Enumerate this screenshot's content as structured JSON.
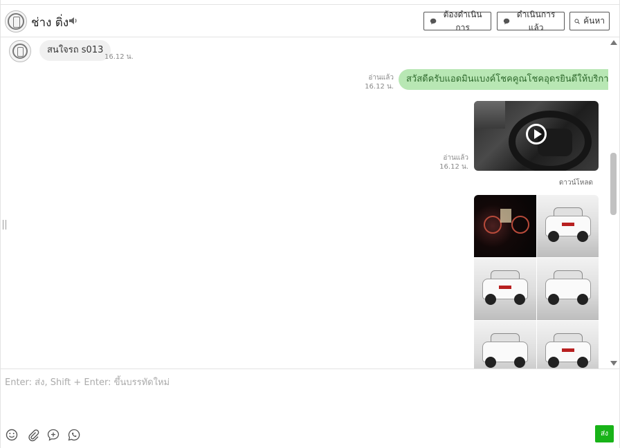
{
  "header": {
    "contact_name": "ช่าง ติ่ง",
    "btn_todo": "ต้องดำเนินการ",
    "btn_done": "ดำเนินการแล้ว",
    "btn_search": "ค้นหา"
  },
  "messages": {
    "incoming": {
      "text": "สนใจรถ s013",
      "time": "16.12 น."
    },
    "outgoing_text": {
      "text": "สวัสดีครับแอดมินแบงค์โชคคูณโชคอุดรยินดีให้บริการครับ",
      "read": "อ่านแล้ว",
      "time": "16.12 น."
    },
    "outgoing_video": {
      "read": "อ่านแล้ว",
      "time": "16.12 น.",
      "download": "ดาวน์โหลด"
    }
  },
  "composer": {
    "placeholder": "Enter: ส่ง, Shift + Enter: ขึ้นบรรทัดใหม่",
    "send_label": "ส่ง"
  },
  "colors": {
    "accent": "#18b318",
    "bubble_out": "#b8e7b4",
    "bubble_in": "#f0f0f0"
  },
  "icons": [
    "speaker-icon",
    "chat-bubble-icon",
    "search-icon",
    "play-icon",
    "emoji-icon",
    "paperclip-icon",
    "sticker-icon",
    "reply-icon"
  ]
}
